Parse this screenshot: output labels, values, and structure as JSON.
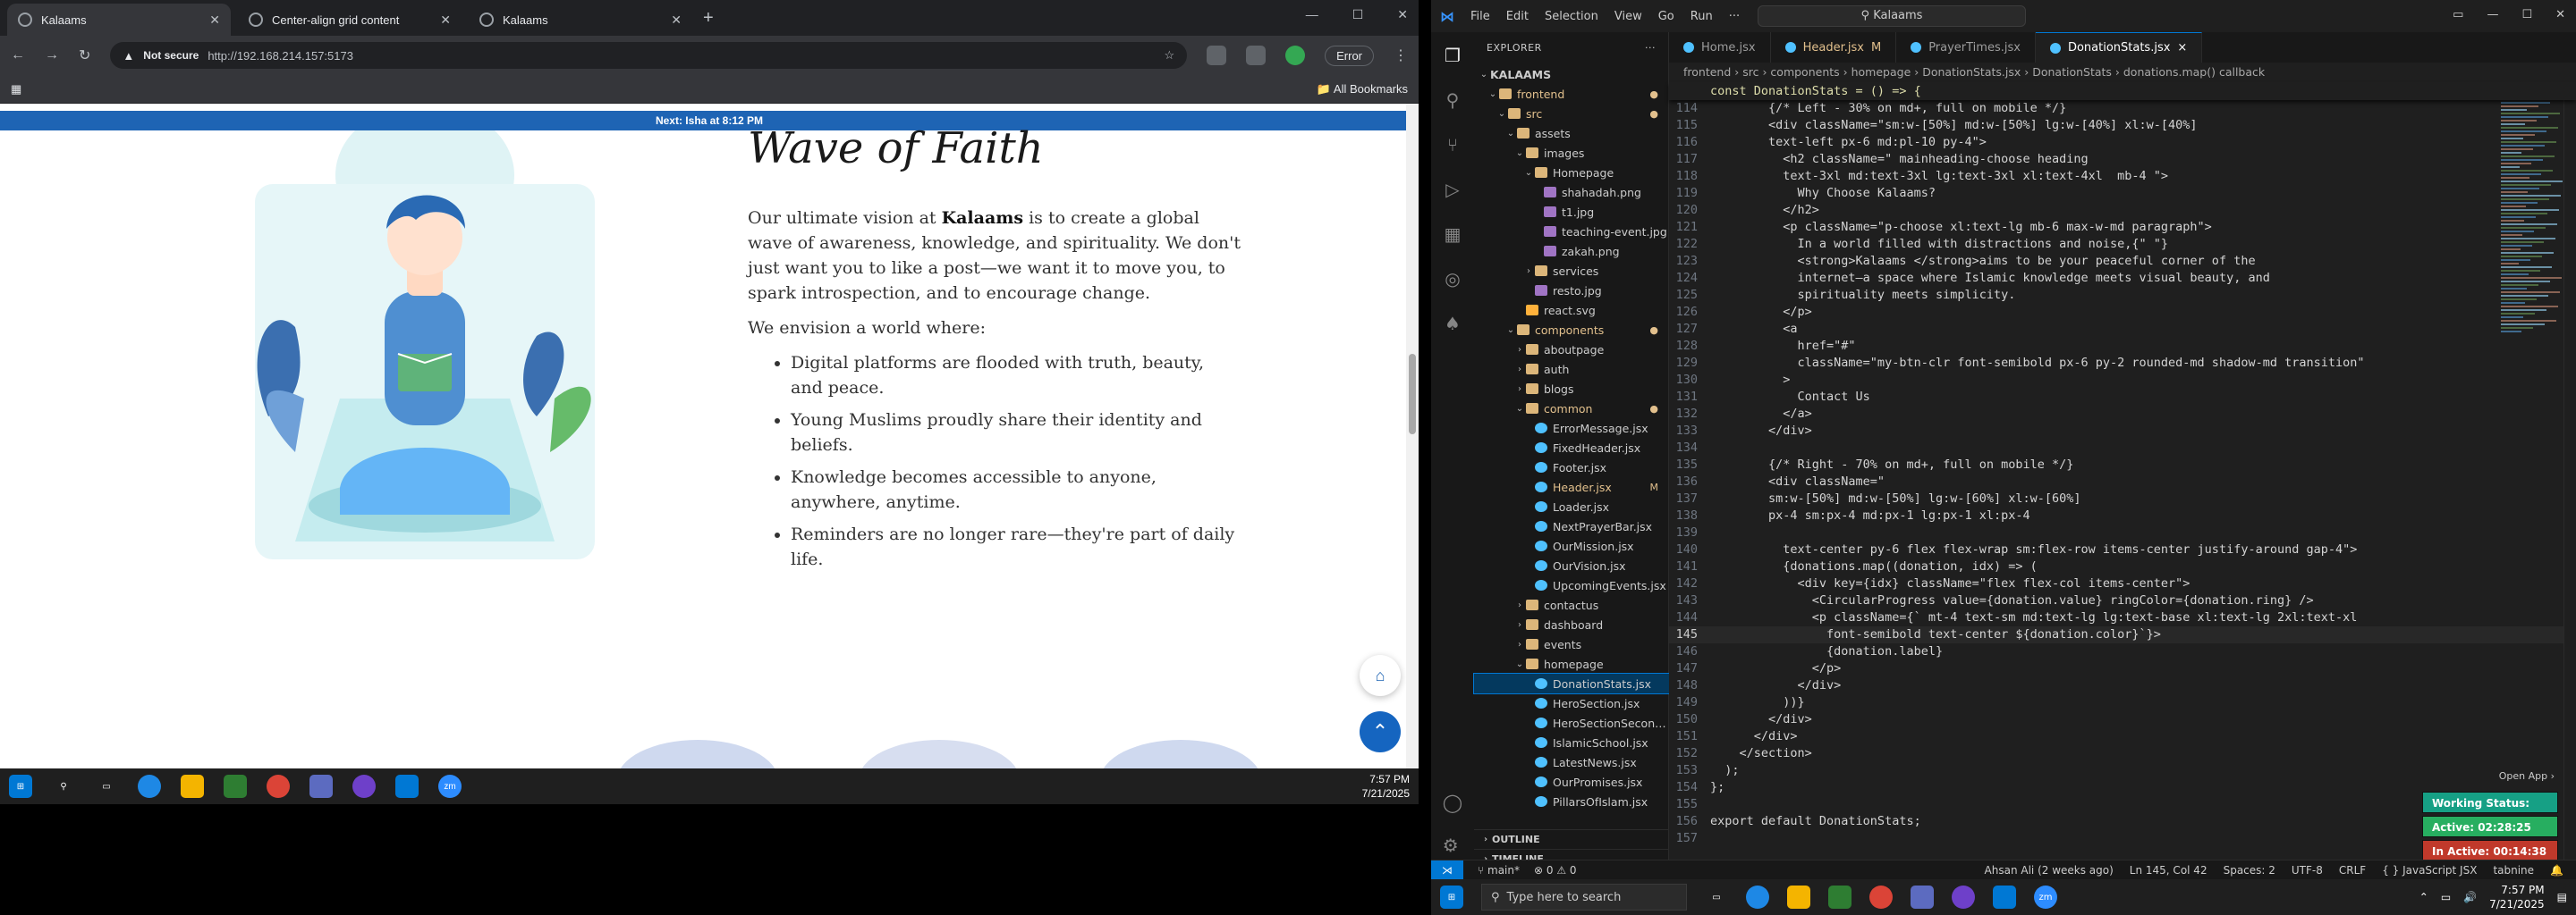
{
  "browser": {
    "tabs": [
      {
        "title": "Kalaams",
        "active": true
      },
      {
        "title": "Center-align grid content",
        "active": false
      },
      {
        "title": "Kalaams",
        "active": false
      }
    ],
    "not_secure": "Not secure",
    "url": "http://192.168.214.157:5173",
    "error_label": "Error",
    "all_bookmarks": "All Bookmarks"
  },
  "page": {
    "prayer_next": "Next: Isha at 8:12 PM",
    "heading": "Wave of Faith",
    "para_pre": "Our ultimate vision at ",
    "para_brand": "Kalaams",
    "para_post": " is to create a global wave of awareness, knowledge, and spirituality. We don't just want you to like a post—we want it to move you, to spark introspection, and to encourage change.",
    "envision": "We envision a world where:",
    "bullets": [
      "Digital platforms are flooded with truth, beauty, and peace.",
      "Young Muslims proudly share their identity and beliefs.",
      "Knowledge becomes accessible to anyone, anywhere, anytime.",
      "Reminders are no longer rare—they're part of daily life."
    ]
  },
  "taskbar1": {
    "time": "7:57 PM",
    "date": "7/21/2025"
  },
  "vscode": {
    "menu": [
      "File",
      "Edit",
      "Selection",
      "View",
      "Go",
      "Run",
      "···"
    ],
    "command_center": "Kalaams",
    "explorer_title": "EXPLORER",
    "tree": [
      {
        "depth": 0,
        "type": "root",
        "name": "KALAAMS",
        "open": true
      },
      {
        "depth": 1,
        "type": "folder",
        "name": "frontend",
        "open": true,
        "badge": "●",
        "orange": true
      },
      {
        "depth": 2,
        "type": "folder",
        "name": "src",
        "open": true,
        "badge": "●",
        "orange": true
      },
      {
        "depth": 3,
        "type": "folder",
        "name": "assets",
        "open": true
      },
      {
        "depth": 4,
        "type": "folder",
        "name": "images",
        "open": true
      },
      {
        "depth": 5,
        "type": "folder",
        "name": "Homepage",
        "open": true
      },
      {
        "depth": 6,
        "type": "img",
        "name": "shahadah.png"
      },
      {
        "depth": 6,
        "type": "img",
        "name": "t1.jpg"
      },
      {
        "depth": 6,
        "type": "img",
        "name": "teaching-event.jpg"
      },
      {
        "depth": 6,
        "type": "img",
        "name": "zakah.png"
      },
      {
        "depth": 5,
        "type": "folder",
        "name": "services",
        "open": false
      },
      {
        "depth": 5,
        "type": "img",
        "name": "resto.jpg"
      },
      {
        "depth": 4,
        "type": "svg",
        "name": "react.svg"
      },
      {
        "depth": 3,
        "type": "folder",
        "name": "components",
        "open": true,
        "badge": "●",
        "orange": true
      },
      {
        "depth": 4,
        "type": "folder",
        "name": "aboutpage",
        "open": false
      },
      {
        "depth": 4,
        "type": "folder",
        "name": "auth",
        "open": false
      },
      {
        "depth": 4,
        "type": "folder",
        "name": "blogs",
        "open": false
      },
      {
        "depth": 4,
        "type": "folder",
        "name": "common",
        "open": true,
        "badge": "●",
        "orange": true
      },
      {
        "depth": 5,
        "type": "jsx",
        "name": "ErrorMessage.jsx"
      },
      {
        "depth": 5,
        "type": "jsx",
        "name": "FixedHeader.jsx"
      },
      {
        "depth": 5,
        "type": "jsx",
        "name": "Footer.jsx"
      },
      {
        "depth": 5,
        "type": "jsx",
        "name": "Header.jsx",
        "badge": "M",
        "orange": true
      },
      {
        "depth": 5,
        "type": "jsx",
        "name": "Loader.jsx"
      },
      {
        "depth": 5,
        "type": "jsx",
        "name": "NextPrayerBar.jsx"
      },
      {
        "depth": 5,
        "type": "jsx",
        "name": "OurMission.jsx"
      },
      {
        "depth": 5,
        "type": "jsx",
        "name": "OurVision.jsx"
      },
      {
        "depth": 5,
        "type": "jsx",
        "name": "UpcomingEvents.jsx"
      },
      {
        "depth": 4,
        "type": "folder",
        "name": "contactus",
        "open": false
      },
      {
        "depth": 4,
        "type": "folder",
        "name": "dashboard",
        "open": false
      },
      {
        "depth": 4,
        "type": "folder",
        "name": "events",
        "open": false
      },
      {
        "depth": 4,
        "type": "folder",
        "name": "homepage",
        "open": true
      },
      {
        "depth": 5,
        "type": "jsx",
        "name": "DonationStats.jsx",
        "selected": true
      },
      {
        "depth": 5,
        "type": "jsx",
        "name": "HeroSection.jsx"
      },
      {
        "depth": 5,
        "type": "jsx",
        "name": "HeroSectionSecond.j..."
      },
      {
        "depth": 5,
        "type": "jsx",
        "name": "IslamicSchool.jsx"
      },
      {
        "depth": 5,
        "type": "jsx",
        "name": "LatestNews.jsx"
      },
      {
        "depth": 5,
        "type": "jsx",
        "name": "OurPromises.jsx"
      },
      {
        "depth": 5,
        "type": "jsx",
        "name": "PillarsOfIslam.jsx"
      }
    ],
    "outline": "OUTLINE",
    "timeline": "TIMELINE",
    "tabs": [
      {
        "name": "Home.jsx",
        "active": false,
        "mod": ""
      },
      {
        "name": "Header.jsx",
        "active": false,
        "mod": "M"
      },
      {
        "name": "PrayerTimes.jsx",
        "active": false,
        "mod": ""
      },
      {
        "name": "DonationStats.jsx",
        "active": true,
        "mod": "×"
      }
    ],
    "breadcrumb": "frontend › src › components › homepage › DonationStats.jsx › DonationStats › donations.map() callback",
    "sticky": "const DonationStats = () => {",
    "code_lines": [
      {
        "n": "114",
        "t": "        {/* Left - 30% on md+, full on mobile */}",
        "c": "cm"
      },
      {
        "n": "115",
        "t": "        <div className=\"sm:w-[50%] md:w-[50%] lg:w-[40%] xl:w-[40%]",
        "c": "tg"
      },
      {
        "n": "116",
        "t": "        text-left px-6 md:pl-10 py-4\">",
        "c": "s"
      },
      {
        "n": "117",
        "t": "          <h2 className=\" mainheading-choose heading",
        "c": "tg"
      },
      {
        "n": "118",
        "t": "          text-3xl md:text-3xl lg:text-3xl xl:text-4xl  mb-4 \">",
        "c": "s"
      },
      {
        "n": "119",
        "t": "            Why Choose Kalaams?",
        "c": ""
      },
      {
        "n": "120",
        "t": "          </h2>",
        "c": "tg"
      },
      {
        "n": "121",
        "t": "          <p className=\"p-choose xl:text-lg mb-6 max-w-md paragraph\">",
        "c": "tg"
      },
      {
        "n": "122",
        "t": "            In a world filled with distractions and noise,{\" \"}",
        "c": ""
      },
      {
        "n": "123",
        "t": "            <strong>Kalaams </strong>aims to be your peaceful corner of the",
        "c": ""
      },
      {
        "n": "124",
        "t": "            internet—a space where Islamic knowledge meets visual beauty, and",
        "c": ""
      },
      {
        "n": "125",
        "t": "            spirituality meets simplicity.",
        "c": ""
      },
      {
        "n": "126",
        "t": "          </p>",
        "c": "tg"
      },
      {
        "n": "127",
        "t": "          <a",
        "c": "tg"
      },
      {
        "n": "128",
        "t": "            href=\"#\"",
        "c": "at"
      },
      {
        "n": "129",
        "t": "            className=\"my-btn-clr font-semibold px-6 py-2 rounded-md shadow-md transition\"",
        "c": "at"
      },
      {
        "n": "130",
        "t": "          >",
        "c": "tg"
      },
      {
        "n": "131",
        "t": "            Contact Us",
        "c": ""
      },
      {
        "n": "132",
        "t": "          </a>",
        "c": "tg"
      },
      {
        "n": "133",
        "t": "        </div>",
        "c": "tg"
      },
      {
        "n": "134",
        "t": "",
        "c": ""
      },
      {
        "n": "135",
        "t": "        {/* Right - 70% on md+, full on mobile */}",
        "c": "cm"
      },
      {
        "n": "136",
        "t": "        <div className=\"",
        "c": "tg"
      },
      {
        "n": "137",
        "t": "        sm:w-[50%] md:w-[50%] lg:w-[60%] xl:w-[60%]",
        "c": "s"
      },
      {
        "n": "138",
        "t": "        px-4 sm:px-4 md:px-1 lg:px-1 xl:px-4",
        "c": "s"
      },
      {
        "n": "139",
        "t": "",
        "c": ""
      },
      {
        "n": "140",
        "t": "          text-center py-6 flex flex-wrap sm:flex-row items-center justify-around gap-4\">",
        "c": "s"
      },
      {
        "n": "141",
        "t": "          {donations.map((donation, idx) => (",
        "c": "v"
      },
      {
        "n": "142",
        "t": "            <div key={idx} className=\"flex flex-col items-center\">",
        "c": "tg"
      },
      {
        "n": "143",
        "t": "              <CircularProgress value={donation.value} ringColor={donation.ring} />",
        "c": "cl"
      },
      {
        "n": "144",
        "t": "              <p className={` mt-4 text-sm md:text-lg lg:text-base xl:text-lg 2xl:text-xl",
        "c": "tg"
      },
      {
        "n": "145",
        "t": "                font-semibold text-center ${donation.color}`}>",
        "c": "s",
        "cur": true
      },
      {
        "n": "146",
        "t": "                {donation.label}",
        "c": "v"
      },
      {
        "n": "147",
        "t": "              </p>",
        "c": "tg"
      },
      {
        "n": "148",
        "t": "            </div>",
        "c": "tg"
      },
      {
        "n": "149",
        "t": "          ))}",
        "c": "br"
      },
      {
        "n": "150",
        "t": "        </div>",
        "c": "tg"
      },
      {
        "n": "151",
        "t": "      </div>",
        "c": "tg"
      },
      {
        "n": "152",
        "t": "    </section>",
        "c": "tg"
      },
      {
        "n": "153",
        "t": "  );",
        "c": ""
      },
      {
        "n": "154",
        "t": "};",
        "c": ""
      },
      {
        "n": "155",
        "t": "",
        "c": ""
      },
      {
        "n": "156",
        "t": "export default DonationStats;",
        "c": "k"
      },
      {
        "n": "157",
        "t": "",
        "c": ""
      }
    ],
    "open_app": "Open App ›",
    "working_status": "Working Status: Active",
    "active_time": "Active: 02:28:25",
    "inactive_time": "In Active: 00:14:38",
    "status": {
      "branch": "main*",
      "problems": "⊗ 0 ⚠ 0",
      "author": "Ahsan Ali (2 weeks ago)",
      "position": "Ln 145, Col 42",
      "spaces": "Spaces: 2",
      "encoding": "UTF-8",
      "eol": "CRLF",
      "language": "{ } JavaScript JSX",
      "tabnine": "tabnine"
    }
  },
  "taskbar2": {
    "search_placeholder": "Type here to search",
    "time": "7:57 PM",
    "date": "7/21/2025"
  }
}
